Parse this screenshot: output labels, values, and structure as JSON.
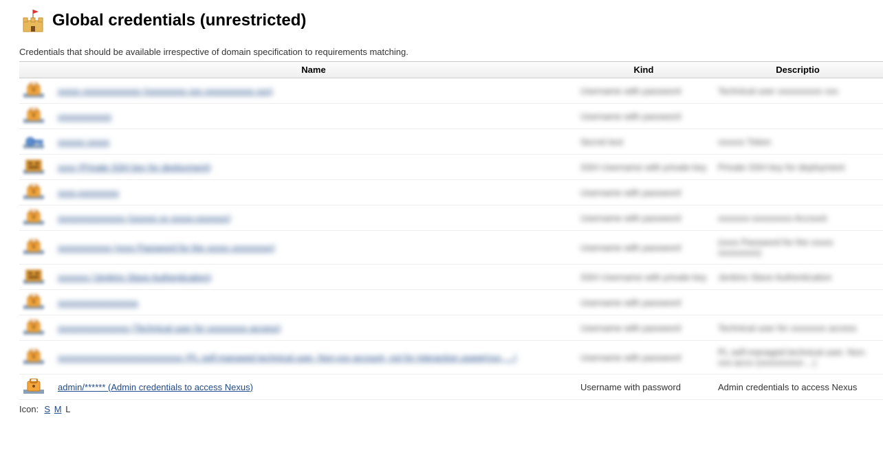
{
  "header": {
    "title": "Global credentials (unrestricted)",
    "description": "Credentials that should be available irrespective of domain specification to requirements matching."
  },
  "table": {
    "headers": {
      "name": "Name",
      "kind": "Kind",
      "description": "Descriptio"
    },
    "rows": [
      {
        "icon": "cred",
        "name_blurred": true,
        "name": "xxxxx xxxxxxxxxxxxx (xxxxxxxxx xxx xxxxxxxxxxx xxx)",
        "kind_blurred": true,
        "kind": "Username with password",
        "desc_blurred": true,
        "desc": "Technical user xxxxxxxxxx xxx"
      },
      {
        "icon": "cred",
        "name_blurred": true,
        "name": "xxxxxxxxxxxx",
        "kind_blurred": true,
        "kind": "Username with password",
        "desc_blurred": true,
        "desc": ""
      },
      {
        "icon": "key",
        "name_blurred": true,
        "name": "xxxxxx xxxxx",
        "kind_blurred": true,
        "kind": "Secret text",
        "desc_blurred": true,
        "desc": "xxxxxx Token"
      },
      {
        "icon": "ssh",
        "name_blurred": true,
        "name": "xxxx (Private SSH key for deployment)",
        "kind_blurred": true,
        "kind": "SSH Username with private key",
        "desc_blurred": true,
        "desc": "Private SSH key for deployment"
      },
      {
        "icon": "cred",
        "name_blurred": true,
        "name": "xxxx-xxxxxxxxx",
        "kind_blurred": true,
        "kind": "Username with password",
        "desc_blurred": true,
        "desc": ""
      },
      {
        "icon": "cred",
        "name_blurred": true,
        "name": "xxxxxxxxxxxxxxx (xxxxxx xx xxxxx-xxxxxxx)",
        "kind_blurred": true,
        "kind": "Username with password",
        "desc_blurred": true,
        "desc": "xxxxxxx-xxxxxxxxx Account"
      },
      {
        "icon": "cred",
        "name_blurred": true,
        "name": "xxxxxxxxxxxx (xxxx Password for the xxxxx xxxxxxxxx)",
        "kind_blurred": true,
        "kind": "Username with password",
        "desc_blurred": true,
        "desc": "(xxxx Password for the xxxxx xxxxxxxxx)"
      },
      {
        "icon": "ssh",
        "name_blurred": true,
        "name": "xxxxxxx (Jenkins Slave Authentication)",
        "kind_blurred": true,
        "kind": "SSH Username with private key",
        "desc_blurred": true,
        "desc": "Jenkins Slave Authentication"
      },
      {
        "icon": "cred",
        "name_blurred": true,
        "name": "xxxxxxxxxxxxxxxxxx",
        "kind_blurred": true,
        "kind": "Username with password",
        "desc_blurred": true,
        "desc": ""
      },
      {
        "icon": "cred",
        "name_blurred": true,
        "name": "xxxxxxxxxxxxxxxx (Technical user for xxxxxxxxx access)",
        "kind_blurred": true,
        "kind": "Username with password",
        "desc_blurred": true,
        "desc": "Technical user for xxxxxxxx access"
      },
      {
        "icon": "cred",
        "name_blurred": true,
        "name": "xxxxxxxxxxxxxxxxxxxxxxxxxxxx (PL self-managed technical user. Non-xxx account, not for interactive usage(xxx, ...)",
        "kind_blurred": true,
        "kind": "Username with password",
        "desc_blurred": true,
        "desc": "PL self-managed technical user. Non-xxx-acco (xxxxxxxxxx ...)"
      },
      {
        "icon": "cred",
        "name_blurred": false,
        "name": "admin/****** (Admin credentials to access Nexus)",
        "kind_blurred": false,
        "kind": "Username with password",
        "desc_blurred": false,
        "desc": "Admin credentials to access Nexus"
      }
    ]
  },
  "footer": {
    "label": "Icon:",
    "sizes": {
      "s": "S",
      "m": "M",
      "l": "L"
    },
    "selected": "L"
  }
}
